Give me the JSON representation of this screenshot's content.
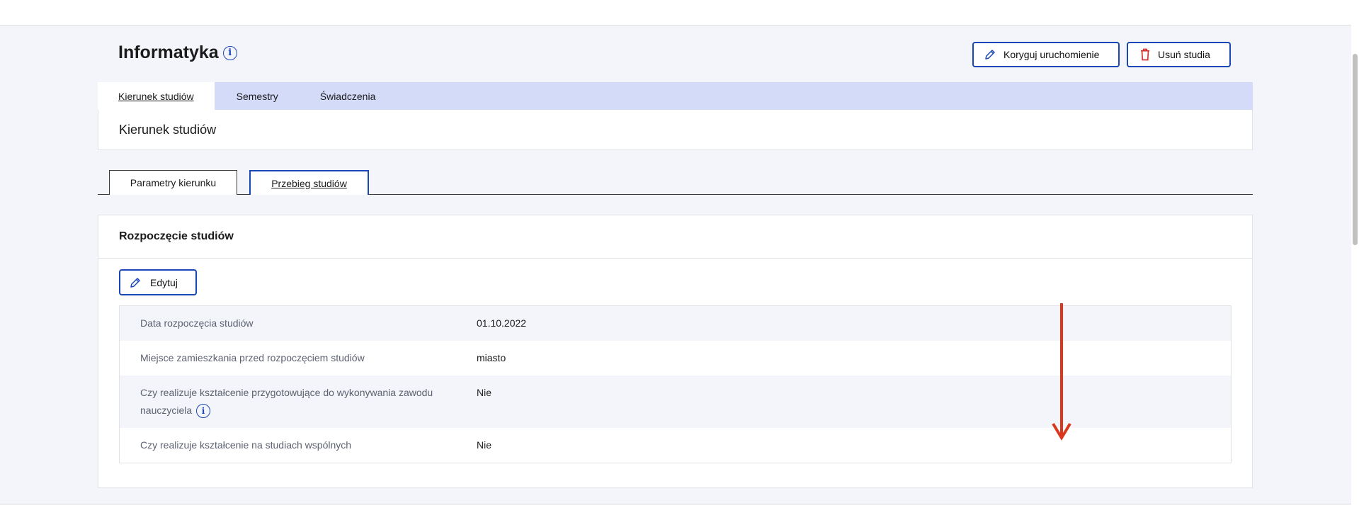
{
  "header": {
    "title": "Informatyka",
    "correct_button": "Koryguj uruchomienie",
    "delete_button": "Usuń studia"
  },
  "tabs": [
    {
      "label": "Kierunek studiów",
      "active": true
    },
    {
      "label": "Semestry",
      "active": false
    },
    {
      "label": "Świadczenia",
      "active": false
    }
  ],
  "section": {
    "title": "Kierunek studiów"
  },
  "subtabs": [
    {
      "label": "Parametry kierunku",
      "active": false
    },
    {
      "label": "Przebieg studiów",
      "active": true
    }
  ],
  "card": {
    "title": "Rozpoczęcie studiów",
    "edit_button": "Edytuj",
    "rows": [
      {
        "label": "Data rozpoczęcia studiów",
        "value": "01.10.2022"
      },
      {
        "label": "Miejsce zamieszkania przed rozpoczęciem studiów",
        "value": "miasto"
      },
      {
        "label": "Czy realizuje kształcenie przygotowujące do wykonywania zawodu nauczyciela",
        "value": "Nie"
      },
      {
        "label": "Czy realizuje kształcenie na studiach wspólnych",
        "value": "Nie"
      }
    ]
  },
  "colors": {
    "accent": "#1a47b8",
    "tab_bar": "#d3dbf9",
    "delete_icon": "#d32f2f",
    "annotation_arrow": "#d9381e"
  },
  "icons": [
    "info-icon",
    "pencil-icon",
    "trash-icon",
    "down-arrow-annotation"
  ]
}
